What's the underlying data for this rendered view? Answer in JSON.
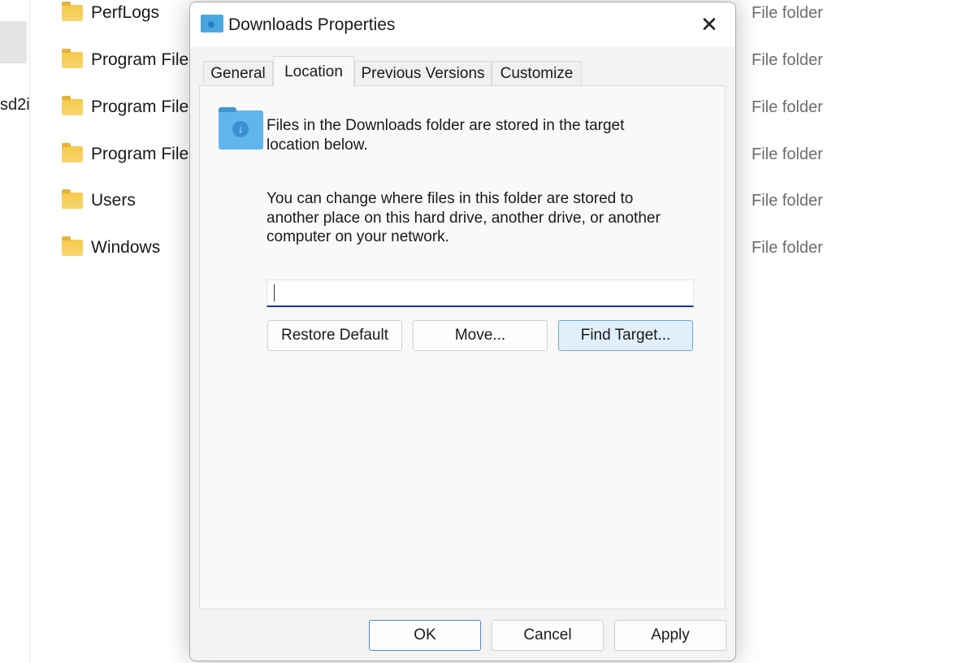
{
  "left_pane": {
    "partial_text": "sd2i"
  },
  "files": [
    {
      "name": "PerfLogs",
      "type": "File folder"
    },
    {
      "name": "Program File",
      "type": "File folder"
    },
    {
      "name": "Program File",
      "type": "File folder"
    },
    {
      "name": "Program File",
      "type": "File folder"
    },
    {
      "name": "Users",
      "type": "File folder"
    },
    {
      "name": "Windows",
      "type": "File folder"
    }
  ],
  "dialog": {
    "title": "Downloads Properties",
    "close": "✕",
    "tabs": [
      {
        "label": "General"
      },
      {
        "label": "Location",
        "active": true
      },
      {
        "label": "Previous Versions"
      },
      {
        "label": "Customize"
      }
    ],
    "info_line1": "Files in the Downloads folder are stored in the target",
    "info_line2": "location below.",
    "desc1": "You can change where files in this folder are stored to",
    "desc2": "another place on this hard drive, another drive, or another",
    "desc3": "computer on your network.",
    "path_value": "",
    "restore_default": "Restore Default",
    "move": "Move...",
    "find_target": "Find Target...",
    "ok": "OK",
    "cancel": "Cancel",
    "apply": "Apply"
  }
}
